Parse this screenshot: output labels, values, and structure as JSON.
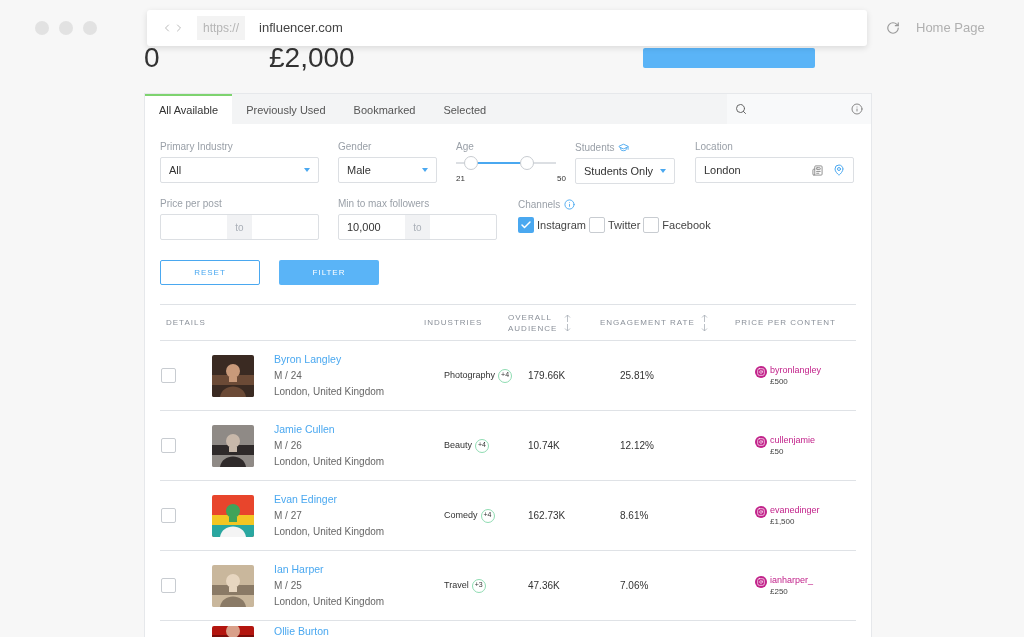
{
  "browser": {
    "protocol": "https://",
    "url": "influencer.com",
    "home": "Home Page"
  },
  "stats": [
    "0",
    "£2,000"
  ],
  "tabs": [
    {
      "label": "All Available",
      "selected": true
    },
    {
      "label": "Previously Used",
      "selected": false
    },
    {
      "label": "Bookmarked",
      "selected": false
    },
    {
      "label": "Selected",
      "selected": false
    }
  ],
  "filters": {
    "primary_industry": {
      "label": "Primary Industry",
      "value": "All"
    },
    "gender": {
      "label": "Gender",
      "value": "Male"
    },
    "age": {
      "label": "Age",
      "min": "21",
      "max": "50",
      "thumbs": [
        {
          "level": 0.15
        },
        {
          "level": 0.71
        }
      ]
    },
    "students": {
      "label": "Students",
      "value": "Students Only"
    },
    "location": {
      "label": "Location",
      "value": "London"
    },
    "price_per_post": {
      "label": "Price per post",
      "separator": "to"
    },
    "followers": {
      "label": "Min to max followers",
      "min": "10,000",
      "separator": "to"
    },
    "channels": {
      "label": "Channels",
      "options": [
        {
          "label": "Instagram",
          "checked": true
        },
        {
          "label": "Twitter",
          "checked": false
        },
        {
          "label": "Facebook",
          "checked": false
        }
      ]
    }
  },
  "buttons": {
    "reset": "RESET",
    "filter": "FILTER"
  },
  "table": {
    "columns": [
      {
        "label": "DETAILS",
        "sortable": false
      },
      {
        "label": "INDUSTRIES",
        "sortable": false
      },
      {
        "label": "OVERALL AUDIENCE",
        "sortable": true
      },
      {
        "label": "ENGAGEMENT RATE",
        "sortable": true
      },
      {
        "label": "PRICE PER CONTENT",
        "sortable": false
      }
    ],
    "rows": [
      {
        "selected": false,
        "name": "Byron Langley",
        "gender_age": "M / 24",
        "location": "London, United Kingdom",
        "industry": "Photography",
        "more": "+4",
        "audience": "179.66K",
        "engagement": "25.81%",
        "handle": "byronlangley",
        "price": "£500"
      },
      {
        "selected": false,
        "name": "Jamie Cullen",
        "gender_age": "M / 26",
        "location": "London, United Kingdom",
        "industry": "Beauty",
        "more": "+4",
        "audience": "10.74K",
        "engagement": "12.12%",
        "handle": "cullenjamie",
        "price": "£50"
      },
      {
        "selected": false,
        "name": "Evan Edinger",
        "gender_age": "M / 27",
        "location": "London, United Kingdom",
        "industry": "Comedy",
        "more": "+4",
        "audience": "162.73K",
        "engagement": "8.61%",
        "handle": "evanedinger",
        "price": "£1,500"
      },
      {
        "selected": false,
        "name": "Ian Harper",
        "gender_age": "M / 25",
        "location": "London, United Kingdom",
        "industry": "Travel",
        "more": "+3",
        "audience": "47.36K",
        "engagement": "7.06%",
        "handle": "ianharper_",
        "price": "£250"
      }
    ],
    "partial_row": {
      "name": "Ollie Burton"
    }
  }
}
